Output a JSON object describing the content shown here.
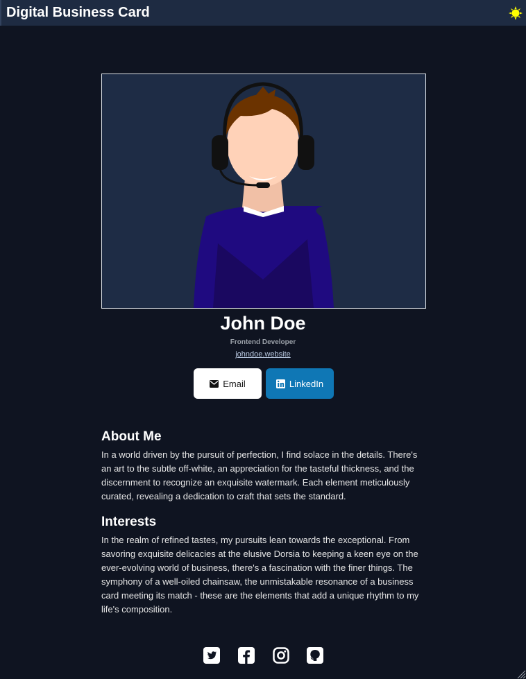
{
  "app": {
    "title": "Digital Business Card"
  },
  "profile": {
    "name": "John Doe",
    "role": "Frontend Developer",
    "website": "johndoe.website"
  },
  "actions": {
    "email_label": "Email",
    "linkedin_label": "LinkedIn"
  },
  "about": {
    "heading": "About Me",
    "text": "In a world driven by the pursuit of perfection, I find solace in the details. There's an art to the subtle off-white, an appreciation for the tasteful thickness, and the discernment to recognize an exquisite watermark. Each element meticulously curated, revealing a dedication to craft that sets the standard."
  },
  "interests": {
    "heading": "Interests",
    "text": "In the realm of refined tastes, my pursuits lean towards the exceptional. From savoring exquisite delicacies at the elusive Dorsia to keeping a keen eye on the ever-evolving world of business, there's a fascination with the finer things. The symphony of a well-oiled chainsaw, the unmistakable resonance of a business card meeting its match - these are the elements that add a unique rhythm to my life's composition."
  },
  "icons": {
    "theme_toggle": "sun-icon",
    "email": "envelope-icon",
    "linkedin": "linkedin-icon",
    "social": [
      "twitter-icon",
      "facebook-icon",
      "instagram-icon",
      "github-icon"
    ]
  },
  "colors": {
    "background": "#0f1421",
    "titlebar": "#1e2b42",
    "photo_bg": "#1e2c45",
    "linkedin_blue": "#0f77b5",
    "sun_yellow": "#ffff00"
  }
}
